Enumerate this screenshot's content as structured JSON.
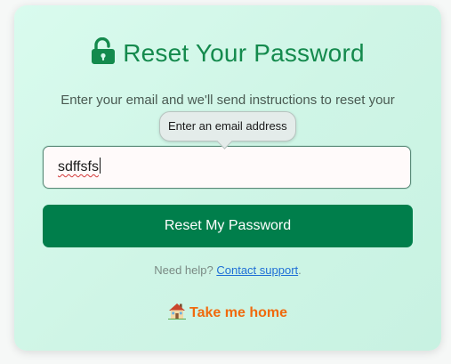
{
  "form": {
    "title": "Reset Your Password",
    "subtitle": "Enter your email and we'll send instructions to reset your",
    "email_value": "sdffsfs",
    "validation_tooltip": "Enter an email address",
    "submit_label": "Reset My Password"
  },
  "help": {
    "prefix": "Need help?",
    "link_label": "Contact support",
    "suffix": "."
  },
  "home_link": {
    "label": "Take me home"
  },
  "icons": {
    "title_icon": "unlock-icon",
    "home_icon": "house-icon"
  },
  "colors": {
    "accent_green": "#148a4d",
    "button_green": "#007e4b",
    "home_orange": "#f06a0d",
    "link_blue": "#1f6fd6"
  }
}
